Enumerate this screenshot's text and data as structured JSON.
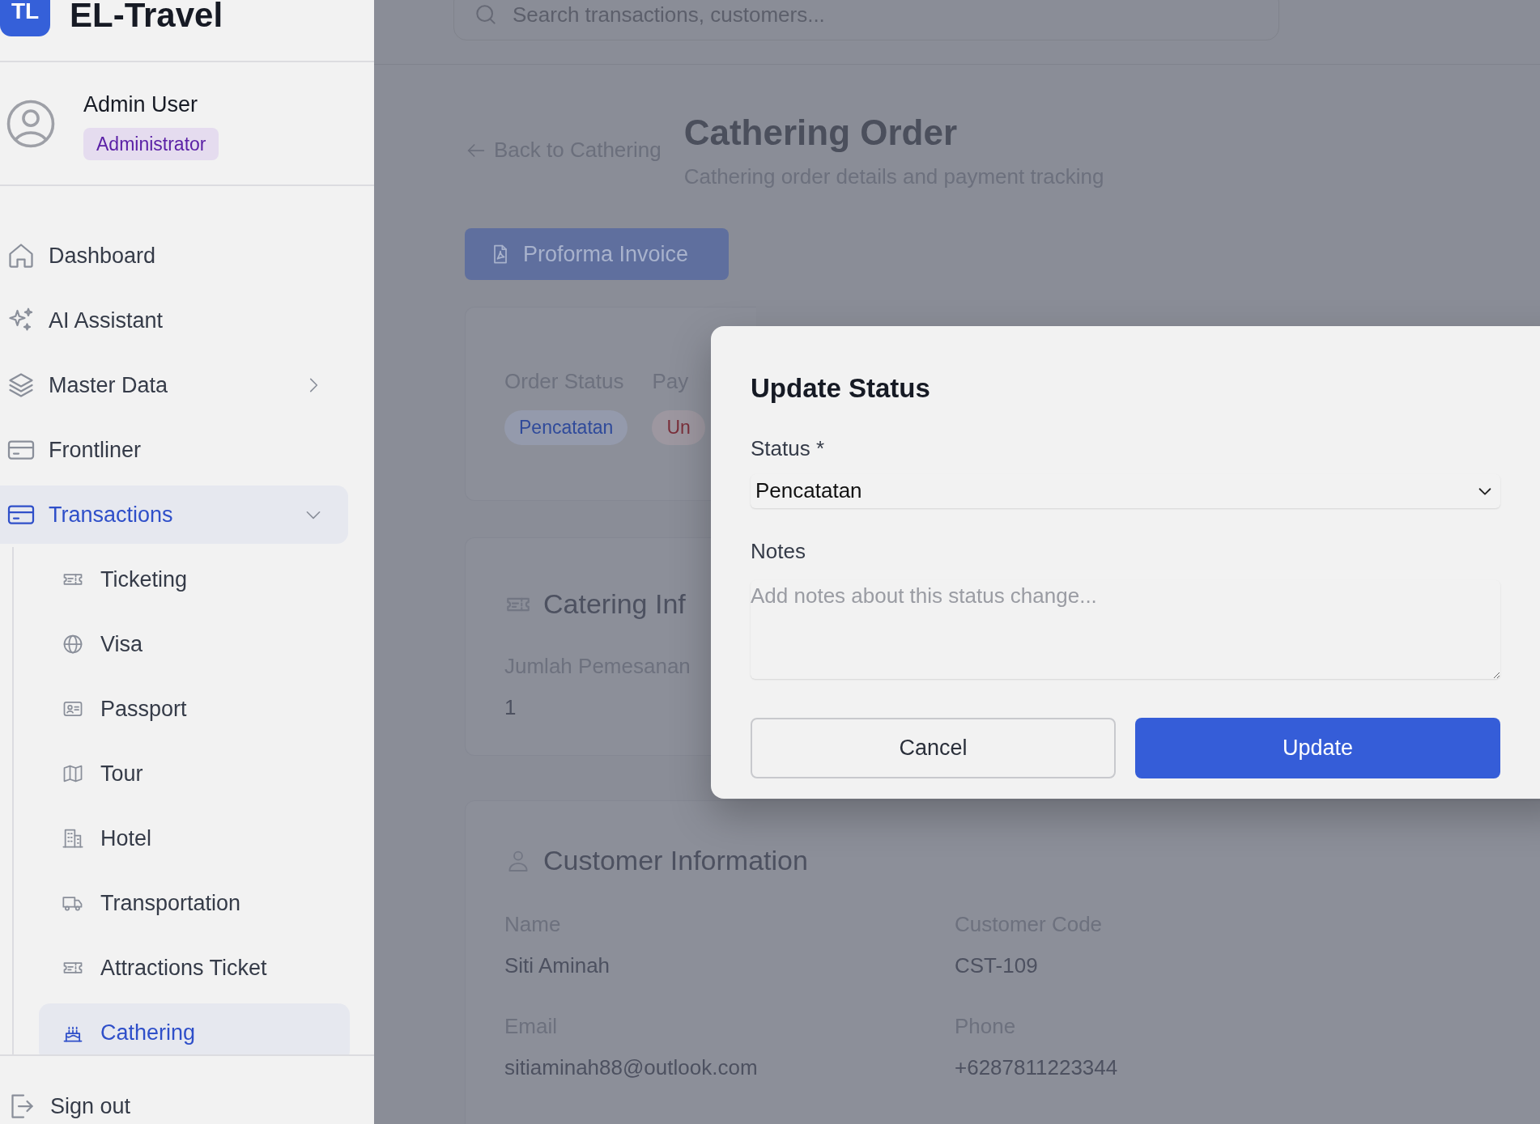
{
  "brand": {
    "logo": "TL",
    "name": "EL-Travel"
  },
  "user": {
    "name": "Admin User",
    "role": "Administrator"
  },
  "nav": [
    {
      "label": "Dashboard",
      "kind": "home",
      "selected": false
    },
    {
      "label": "AI Assistant",
      "kind": "sparkles",
      "selected": false
    },
    {
      "label": "Master Data",
      "kind": "layers",
      "selected": false,
      "expanded": false
    },
    {
      "label": "Frontliner",
      "kind": "card",
      "selected": false
    },
    {
      "label": "Transactions",
      "kind": "card",
      "selected": true,
      "expanded": true,
      "children": [
        {
          "label": "Ticketing",
          "kind": "ticket",
          "selected": false
        },
        {
          "label": "Visa",
          "kind": "globe",
          "selected": false
        },
        {
          "label": "Passport",
          "kind": "idcard",
          "selected": false
        },
        {
          "label": "Tour",
          "kind": "map",
          "selected": false
        },
        {
          "label": "Hotel",
          "kind": "building",
          "selected": false
        },
        {
          "label": "Transportation",
          "kind": "truck",
          "selected": false
        },
        {
          "label": "Attractions Ticket",
          "kind": "ticket",
          "selected": false
        },
        {
          "label": "Cathering",
          "kind": "cake",
          "selected": true
        }
      ]
    }
  ],
  "sign_out": "Sign out",
  "search": {
    "placeholder": "Search transactions, customers..."
  },
  "back_link": "Back to Cathering",
  "page": {
    "title": "Cathering Order",
    "subtitle": "Cathering order details and payment tracking"
  },
  "proforma_button": "Proforma Invoice",
  "status_card": {
    "fields": [
      {
        "label": "Order Status",
        "badge": "Pencatatan",
        "color": "#2f4a9a"
      },
      {
        "label": "Pay",
        "badge": "Un",
        "color": "#7a2f3a"
      }
    ]
  },
  "catering_card": {
    "title": "Catering Inf",
    "fields": [
      {
        "label": "Jumlah Pemesanan",
        "value": "1"
      }
    ]
  },
  "customer_card": {
    "title": "Customer Information",
    "fields": [
      {
        "label": "Name",
        "value": "Siti Aminah"
      },
      {
        "label": "Customer Code",
        "value": "CST-109"
      },
      {
        "label": "Email",
        "value": "sitiaminah88@outlook.com"
      },
      {
        "label": "Phone",
        "value": "+6287811223344"
      }
    ]
  },
  "modal": {
    "title": "Update Status",
    "status_label": "Status *",
    "status_value": "Pencatatan",
    "notes_label": "Notes",
    "notes_placeholder": "Add notes about this status change...",
    "buttons": [
      {
        "label": "Cancel",
        "kind": "secondary"
      },
      {
        "label": "Update",
        "kind": "primary"
      }
    ]
  }
}
